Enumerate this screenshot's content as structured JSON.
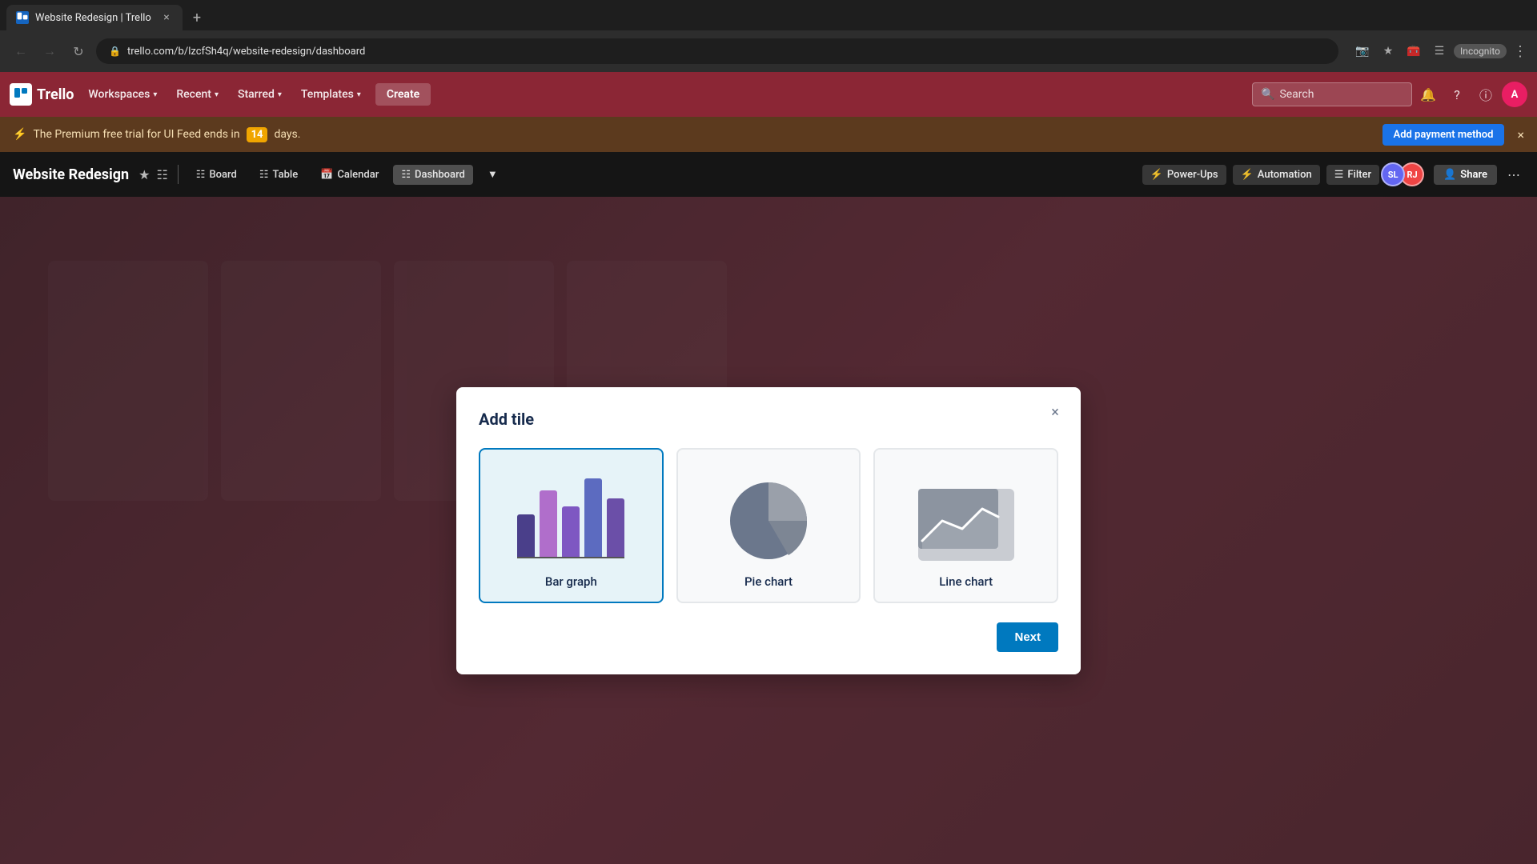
{
  "browser": {
    "tab_title": "Website Redesign | Trello",
    "tab_favicon": "T",
    "url": "trello.com/b/lzcfSh4q/website-redesign/dashboard",
    "url_full": "trello.com/b/lzcfSh4q/website-redesign/dashboard",
    "incognito_label": "Incognito"
  },
  "nav": {
    "logo_text": "Trello",
    "workspaces_label": "Workspaces",
    "recent_label": "Recent",
    "starred_label": "Starred",
    "templates_label": "Templates",
    "create_label": "Create",
    "search_placeholder": "Search",
    "search_label": "Search"
  },
  "trial_banner": {
    "text_before": "The Premium free trial for UI Feed ends in",
    "days_count": "14",
    "text_after": "days.",
    "add_payment_label": "Add payment method"
  },
  "board_header": {
    "title": "Website Redesign",
    "board_label": "Board",
    "table_label": "Table",
    "calendar_label": "Calendar",
    "dashboard_label": "Dashboard",
    "power_ups_label": "Power-Ups",
    "automation_label": "Automation",
    "filter_label": "Filter",
    "share_label": "Share",
    "member1_initials": "SL",
    "member1_color": "#6366f1",
    "member2_initials": "RJ",
    "member2_color": "#ef4444"
  },
  "modal": {
    "title": "Add tile",
    "close_label": "×",
    "chart_options": [
      {
        "id": "bar-graph",
        "label": "Bar graph",
        "selected": true
      },
      {
        "id": "pie-chart",
        "label": "Pie chart",
        "selected": false
      },
      {
        "id": "line-chart",
        "label": "Line chart",
        "selected": false
      }
    ],
    "next_button_label": "Next"
  },
  "colors": {
    "trello_red": "#8b2635",
    "trello_blue": "#0079bf",
    "bar1": "#4a3f8a",
    "bar2": "#b06ecb",
    "bar3": "#6b4fa8",
    "bar4": "#5c6bc0",
    "bar5": "#7e57c2",
    "pie_main": "#6b778c",
    "pie_slice": "#9aa0aa",
    "line_color": "#6b778c",
    "modal_bg": "white"
  }
}
